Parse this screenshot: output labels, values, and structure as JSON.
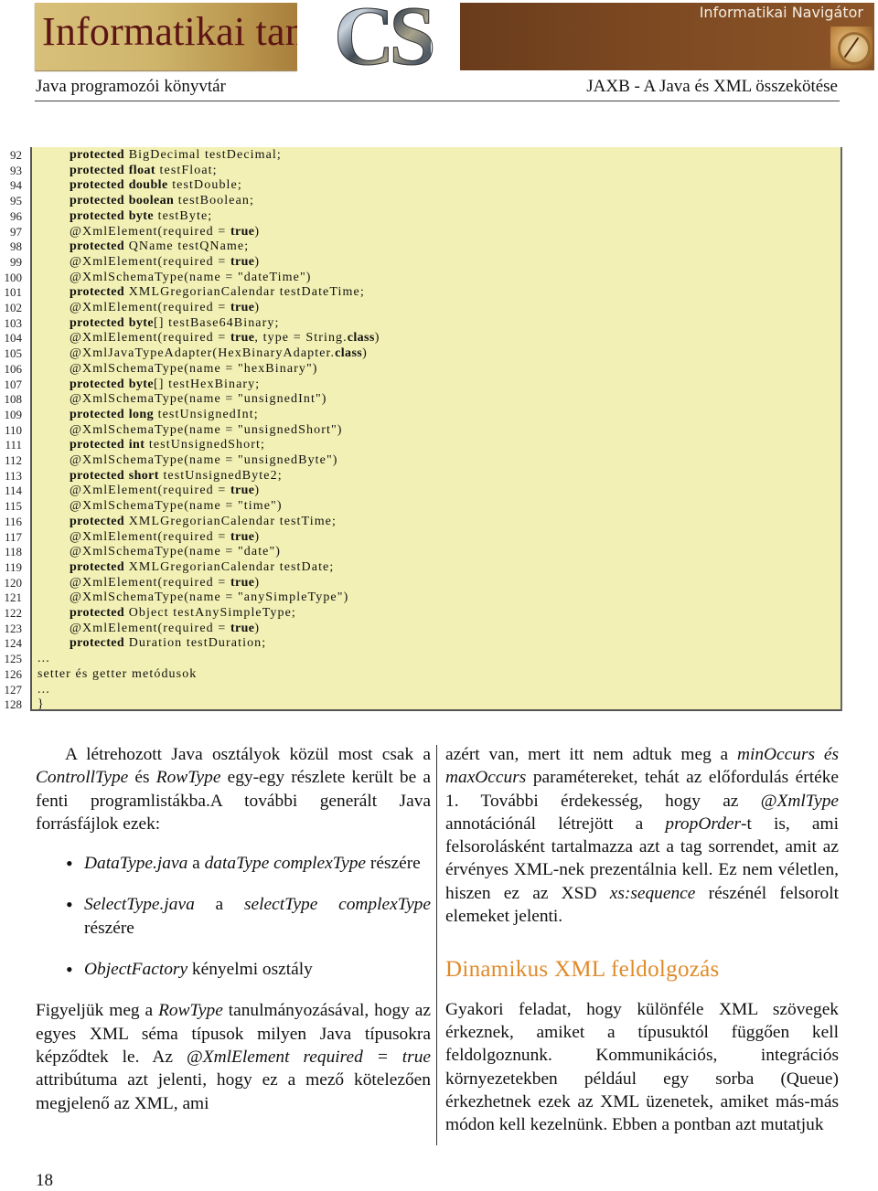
{
  "banner": {
    "title": "Informatikai tanulmányok",
    "logo_text": "CS",
    "navigator": "Informatikai Navigátor"
  },
  "running_head": {
    "left": "Java programozói könyvtár",
    "right": "JAXB - A Java és XML összekötése"
  },
  "colors": {
    "code_background": "#f2f0b4",
    "section_title": "#e08a2a",
    "banner_title": "#5c1414"
  },
  "listing": {
    "lines": [
      {
        "n": "92",
        "indent": 1,
        "parts": [
          {
            "t": "protected",
            "b": true
          },
          {
            "t": " BigDecimal testDecimal;"
          }
        ]
      },
      {
        "n": "93",
        "indent": 1,
        "parts": [
          {
            "t": "protected",
            "b": true
          },
          {
            "t": " "
          },
          {
            "t": "float",
            "b": true
          },
          {
            "t": " testFloat;"
          }
        ]
      },
      {
        "n": "94",
        "indent": 1,
        "parts": [
          {
            "t": "protected",
            "b": true
          },
          {
            "t": " "
          },
          {
            "t": "double",
            "b": true
          },
          {
            "t": " testDouble;"
          }
        ]
      },
      {
        "n": "95",
        "indent": 1,
        "parts": [
          {
            "t": "protected",
            "b": true
          },
          {
            "t": " "
          },
          {
            "t": "boolean",
            "b": true
          },
          {
            "t": " testBoolean;"
          }
        ]
      },
      {
        "n": "96",
        "indent": 1,
        "parts": [
          {
            "t": "protected",
            "b": true
          },
          {
            "t": " "
          },
          {
            "t": "byte",
            "b": true
          },
          {
            "t": " testByte;"
          }
        ]
      },
      {
        "n": "97",
        "indent": 1,
        "parts": [
          {
            "t": "@XmlElement(required = "
          },
          {
            "t": "true",
            "b": true
          },
          {
            "t": ")"
          }
        ]
      },
      {
        "n": "98",
        "indent": 1,
        "parts": [
          {
            "t": "protected",
            "b": true
          },
          {
            "t": " QName testQName;"
          }
        ]
      },
      {
        "n": "99",
        "indent": 1,
        "parts": [
          {
            "t": "@XmlElement(required = "
          },
          {
            "t": "true",
            "b": true
          },
          {
            "t": ")"
          }
        ]
      },
      {
        "n": "100",
        "indent": 1,
        "parts": [
          {
            "t": "@XmlSchemaType(name = \"dateTime\")"
          }
        ]
      },
      {
        "n": "101",
        "indent": 1,
        "parts": [
          {
            "t": "protected",
            "b": true
          },
          {
            "t": " XMLGregorianCalendar testDateTime;"
          }
        ]
      },
      {
        "n": "102",
        "indent": 1,
        "parts": [
          {
            "t": "@XmlElement(required = "
          },
          {
            "t": "true",
            "b": true
          },
          {
            "t": ")"
          }
        ]
      },
      {
        "n": "103",
        "indent": 1,
        "parts": [
          {
            "t": "protected",
            "b": true
          },
          {
            "t": " "
          },
          {
            "t": "byte",
            "b": true
          },
          {
            "t": "[] testBase64Binary;"
          }
        ]
      },
      {
        "n": "104",
        "indent": 1,
        "parts": [
          {
            "t": "@XmlElement(required = "
          },
          {
            "t": "true",
            "b": true
          },
          {
            "t": ", type = String."
          },
          {
            "t": "class",
            "b": true
          },
          {
            "t": ")"
          }
        ]
      },
      {
        "n": "105",
        "indent": 1,
        "parts": [
          {
            "t": "@XmlJavaTypeAdapter(HexBinaryAdapter."
          },
          {
            "t": "class",
            "b": true
          },
          {
            "t": ")"
          }
        ]
      },
      {
        "n": "106",
        "indent": 1,
        "parts": [
          {
            "t": "@XmlSchemaType(name = \"hexBinary\")"
          }
        ]
      },
      {
        "n": "107",
        "indent": 1,
        "parts": [
          {
            "t": "protected",
            "b": true
          },
          {
            "t": " "
          },
          {
            "t": "byte",
            "b": true
          },
          {
            "t": "[] testHexBinary;"
          }
        ]
      },
      {
        "n": "108",
        "indent": 1,
        "parts": [
          {
            "t": "@XmlSchemaType(name = \"unsignedInt\")"
          }
        ]
      },
      {
        "n": "109",
        "indent": 1,
        "parts": [
          {
            "t": "protected",
            "b": true
          },
          {
            "t": " "
          },
          {
            "t": "long",
            "b": true
          },
          {
            "t": " testUnsignedInt;"
          }
        ]
      },
      {
        "n": "110",
        "indent": 1,
        "parts": [
          {
            "t": "@XmlSchemaType(name = \"unsignedShort\")"
          }
        ]
      },
      {
        "n": "111",
        "indent": 1,
        "parts": [
          {
            "t": "protected",
            "b": true
          },
          {
            "t": " "
          },
          {
            "t": "int",
            "b": true
          },
          {
            "t": " testUnsignedShort;"
          }
        ]
      },
      {
        "n": "112",
        "indent": 1,
        "parts": [
          {
            "t": "@XmlSchemaType(name = \"unsignedByte\")"
          }
        ]
      },
      {
        "n": "113",
        "indent": 1,
        "parts": [
          {
            "t": "protected",
            "b": true
          },
          {
            "t": " "
          },
          {
            "t": "short",
            "b": true
          },
          {
            "t": " testUnsignedByte2;"
          }
        ]
      },
      {
        "n": "114",
        "indent": 1,
        "parts": [
          {
            "t": "@XmlElement(required = "
          },
          {
            "t": "true",
            "b": true
          },
          {
            "t": ")"
          }
        ]
      },
      {
        "n": "115",
        "indent": 1,
        "parts": [
          {
            "t": "@XmlSchemaType(name = \"time\")"
          }
        ]
      },
      {
        "n": "116",
        "indent": 1,
        "parts": [
          {
            "t": "protected",
            "b": true
          },
          {
            "t": " XMLGregorianCalendar testTime;"
          }
        ]
      },
      {
        "n": "117",
        "indent": 1,
        "parts": [
          {
            "t": "@XmlElement(required = "
          },
          {
            "t": "true",
            "b": true
          },
          {
            "t": ")"
          }
        ]
      },
      {
        "n": "118",
        "indent": 1,
        "parts": [
          {
            "t": "@XmlSchemaType(name = \"date\")"
          }
        ]
      },
      {
        "n": "119",
        "indent": 1,
        "parts": [
          {
            "t": "protected",
            "b": true
          },
          {
            "t": " XMLGregorianCalendar testDate;"
          }
        ]
      },
      {
        "n": "120",
        "indent": 1,
        "parts": [
          {
            "t": "@XmlElement(required = "
          },
          {
            "t": "true",
            "b": true
          },
          {
            "t": ")"
          }
        ]
      },
      {
        "n": "121",
        "indent": 1,
        "parts": [
          {
            "t": "@XmlSchemaType(name = \"anySimpleType\")"
          }
        ]
      },
      {
        "n": "122",
        "indent": 1,
        "parts": [
          {
            "t": "protected",
            "b": true
          },
          {
            "t": " Object testAnySimpleType;"
          }
        ]
      },
      {
        "n": "123",
        "indent": 1,
        "parts": [
          {
            "t": "@XmlElement(required = "
          },
          {
            "t": "true",
            "b": true
          },
          {
            "t": ")"
          }
        ]
      },
      {
        "n": "124",
        "indent": 1,
        "parts": [
          {
            "t": "protected",
            "b": true
          },
          {
            "t": " Duration testDuration;"
          }
        ]
      },
      {
        "n": "125",
        "indent": 0,
        "parts": [
          {
            "t": "..."
          }
        ]
      },
      {
        "n": "126",
        "indent": 0,
        "parts": [
          {
            "t": "setter és getter metódusok"
          }
        ]
      },
      {
        "n": "127",
        "indent": 0,
        "parts": [
          {
            "t": "..."
          }
        ]
      },
      {
        "n": "128",
        "indent": 0,
        "parts": [
          {
            "t": "}"
          }
        ]
      }
    ]
  },
  "left_column": {
    "para1": [
      {
        "t": "A létrehozott Java osztályok közül most csak a "
      },
      {
        "t": "ControllType",
        "i": true
      },
      {
        "t": " és "
      },
      {
        "t": "RowType",
        "i": true
      },
      {
        "t": " egy-egy részlete került be a fenti programlistákba.A további generált Java forrásfájlok ezek:"
      }
    ],
    "bullets": [
      [
        {
          "t": "DataType.java",
          "i": true
        },
        {
          "t": " a "
        },
        {
          "t": "dataType complexType",
          "i": true
        },
        {
          "t": " részére"
        }
      ],
      [
        {
          "t": "SelectType.java",
          "i": true
        },
        {
          "t": " a "
        },
        {
          "t": "selectType complexType",
          "i": true
        },
        {
          "t": " részére"
        }
      ],
      [
        {
          "t": "ObjectFactory",
          "i": true
        },
        {
          "t": " kényelmi osztály"
        }
      ]
    ],
    "para2": [
      {
        "t": "Figyeljük meg a "
      },
      {
        "t": "RowType",
        "i": true
      },
      {
        "t": " tanulmányozásával, hogy az egyes XML séma típusok milyen Java típusokra képződtek le.  Az "
      },
      {
        "t": "@XmlElement required = true",
        "i": true
      },
      {
        "t": " attribútuma azt jelenti, hogy ez a mező kötelezően megjelenő az XML, ami"
      }
    ]
  },
  "right_column": {
    "para1": [
      {
        "t": "azért van, mert itt nem adtuk meg a "
      },
      {
        "t": "minOccurs és maxOccurs",
        "i": true
      },
      {
        "t": " paramétereket, tehát az előfordulás értéke 1.  További érdekesség, hogy az "
      },
      {
        "t": "@XmlType",
        "i": true
      },
      {
        "t": " annotációnál létrejött a "
      },
      {
        "t": "propOrder",
        "i": true
      },
      {
        "t": "-t is, ami felsorolásként tartalmazza azt a tag sorrendet, amit az érvényes XML-nek prezentálnia kell.  Ez nem véletlen, hiszen ez az XSD "
      },
      {
        "t": "xs:sequence",
        "i": true
      },
      {
        "t": " részénél felsorolt elemeket jelenti."
      }
    ],
    "section_title": "Dinamikus XML feldolgozás",
    "para2": [
      {
        "t": "Gyakori feladat, hogy különféle XML szövegek érkeznek, amiket a típusuktól függően kell feldolgoznunk.  Kommunikációs, integrációs környezetekben például egy sorba (Queue) érkezhetnek ezek az XML üzenetek, amiket más-más módon kell kezelnünk.  Ebben a pontban azt mutatjuk"
      }
    ]
  },
  "footer": {
    "page_number": "18"
  }
}
